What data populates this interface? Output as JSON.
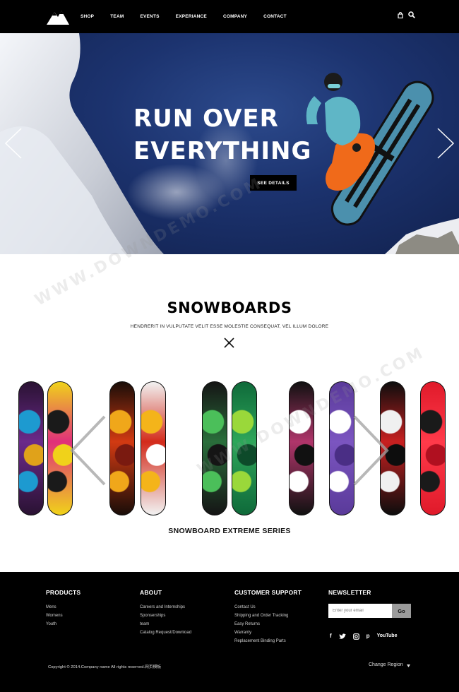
{
  "nav": {
    "links": [
      "SHOP",
      "TEAM",
      "EVENTS",
      "EXPERIANCE",
      "COMPANY",
      "CONTACT"
    ],
    "icons": [
      "bag-icon",
      "search-icon"
    ]
  },
  "hero": {
    "title_line1": "RUN OVER",
    "title_line2": "EVERYTHING",
    "button": "SEE DETAILS"
  },
  "products": {
    "title": "SNOWBOARDS",
    "subtitle": "HENDRERIT IN VULPUTATE VELIT ESSE MOLESTIE CONSEQUAT, VEL ILLUM DOLORE",
    "series_title": "SNOWBOARD EXTREME SERIES",
    "boards": [
      {
        "colors": [
          "#2a1233",
          "#6b2a8a",
          "#1d9ad0",
          "#e0a21a"
        ]
      },
      {
        "colors": [
          "#f0d21a",
          "#e0307a",
          "#1a1a1a",
          "#f0d21a"
        ]
      },
      {
        "colors": [
          "#1a0d08",
          "#d23a12",
          "#f0a71a",
          "#7a1a10"
        ]
      },
      {
        "colors": [
          "#f2f2f2",
          "#d32b1b",
          "#f4b41a",
          "#ffffff"
        ]
      },
      {
        "colors": [
          "#151515",
          "#2a6e3b",
          "#4bbf5a",
          "#151515"
        ]
      },
      {
        "colors": [
          "#0f6a3a",
          "#2ea65a",
          "#9ad83a",
          "#0d4a2a"
        ]
      },
      {
        "colors": [
          "#111111",
          "#b0356a",
          "#ffffff",
          "#111111"
        ]
      },
      {
        "colors": [
          "#5a3a9a",
          "#7b55c0",
          "#ffffff",
          "#4a2e85"
        ]
      },
      {
        "colors": [
          "#0d0d0d",
          "#c82020",
          "#f0f0f0",
          "#0d0d0d"
        ]
      },
      {
        "colors": [
          "#e01a2a",
          "#ff3a4a",
          "#1a1a1a",
          "#b01020"
        ]
      }
    ]
  },
  "footer": {
    "products": {
      "title": "PRODUCTS",
      "links": [
        "Mens",
        "Womens",
        "Youth"
      ]
    },
    "about": {
      "title": "ABOUT",
      "links": [
        "Careers and Internships",
        "Sponserships",
        "team",
        "Catalog Request/Download"
      ]
    },
    "support": {
      "title": "CUSTOMER SUPPORT",
      "links": [
        "Contact Us",
        "Shipping and Order Tracking",
        "Easy Returns",
        "Warranty",
        "Replacement Binding Parts"
      ]
    },
    "newsletter": {
      "title": "NEWSLETTER",
      "placeholder": "Enter your email",
      "button": "Go",
      "social": [
        "f",
        "t",
        "g",
        "p",
        "YouTube"
      ]
    },
    "copyright": "Copyright © 2014.Company name All rights reserved.网页模板",
    "region": "Change Region"
  }
}
